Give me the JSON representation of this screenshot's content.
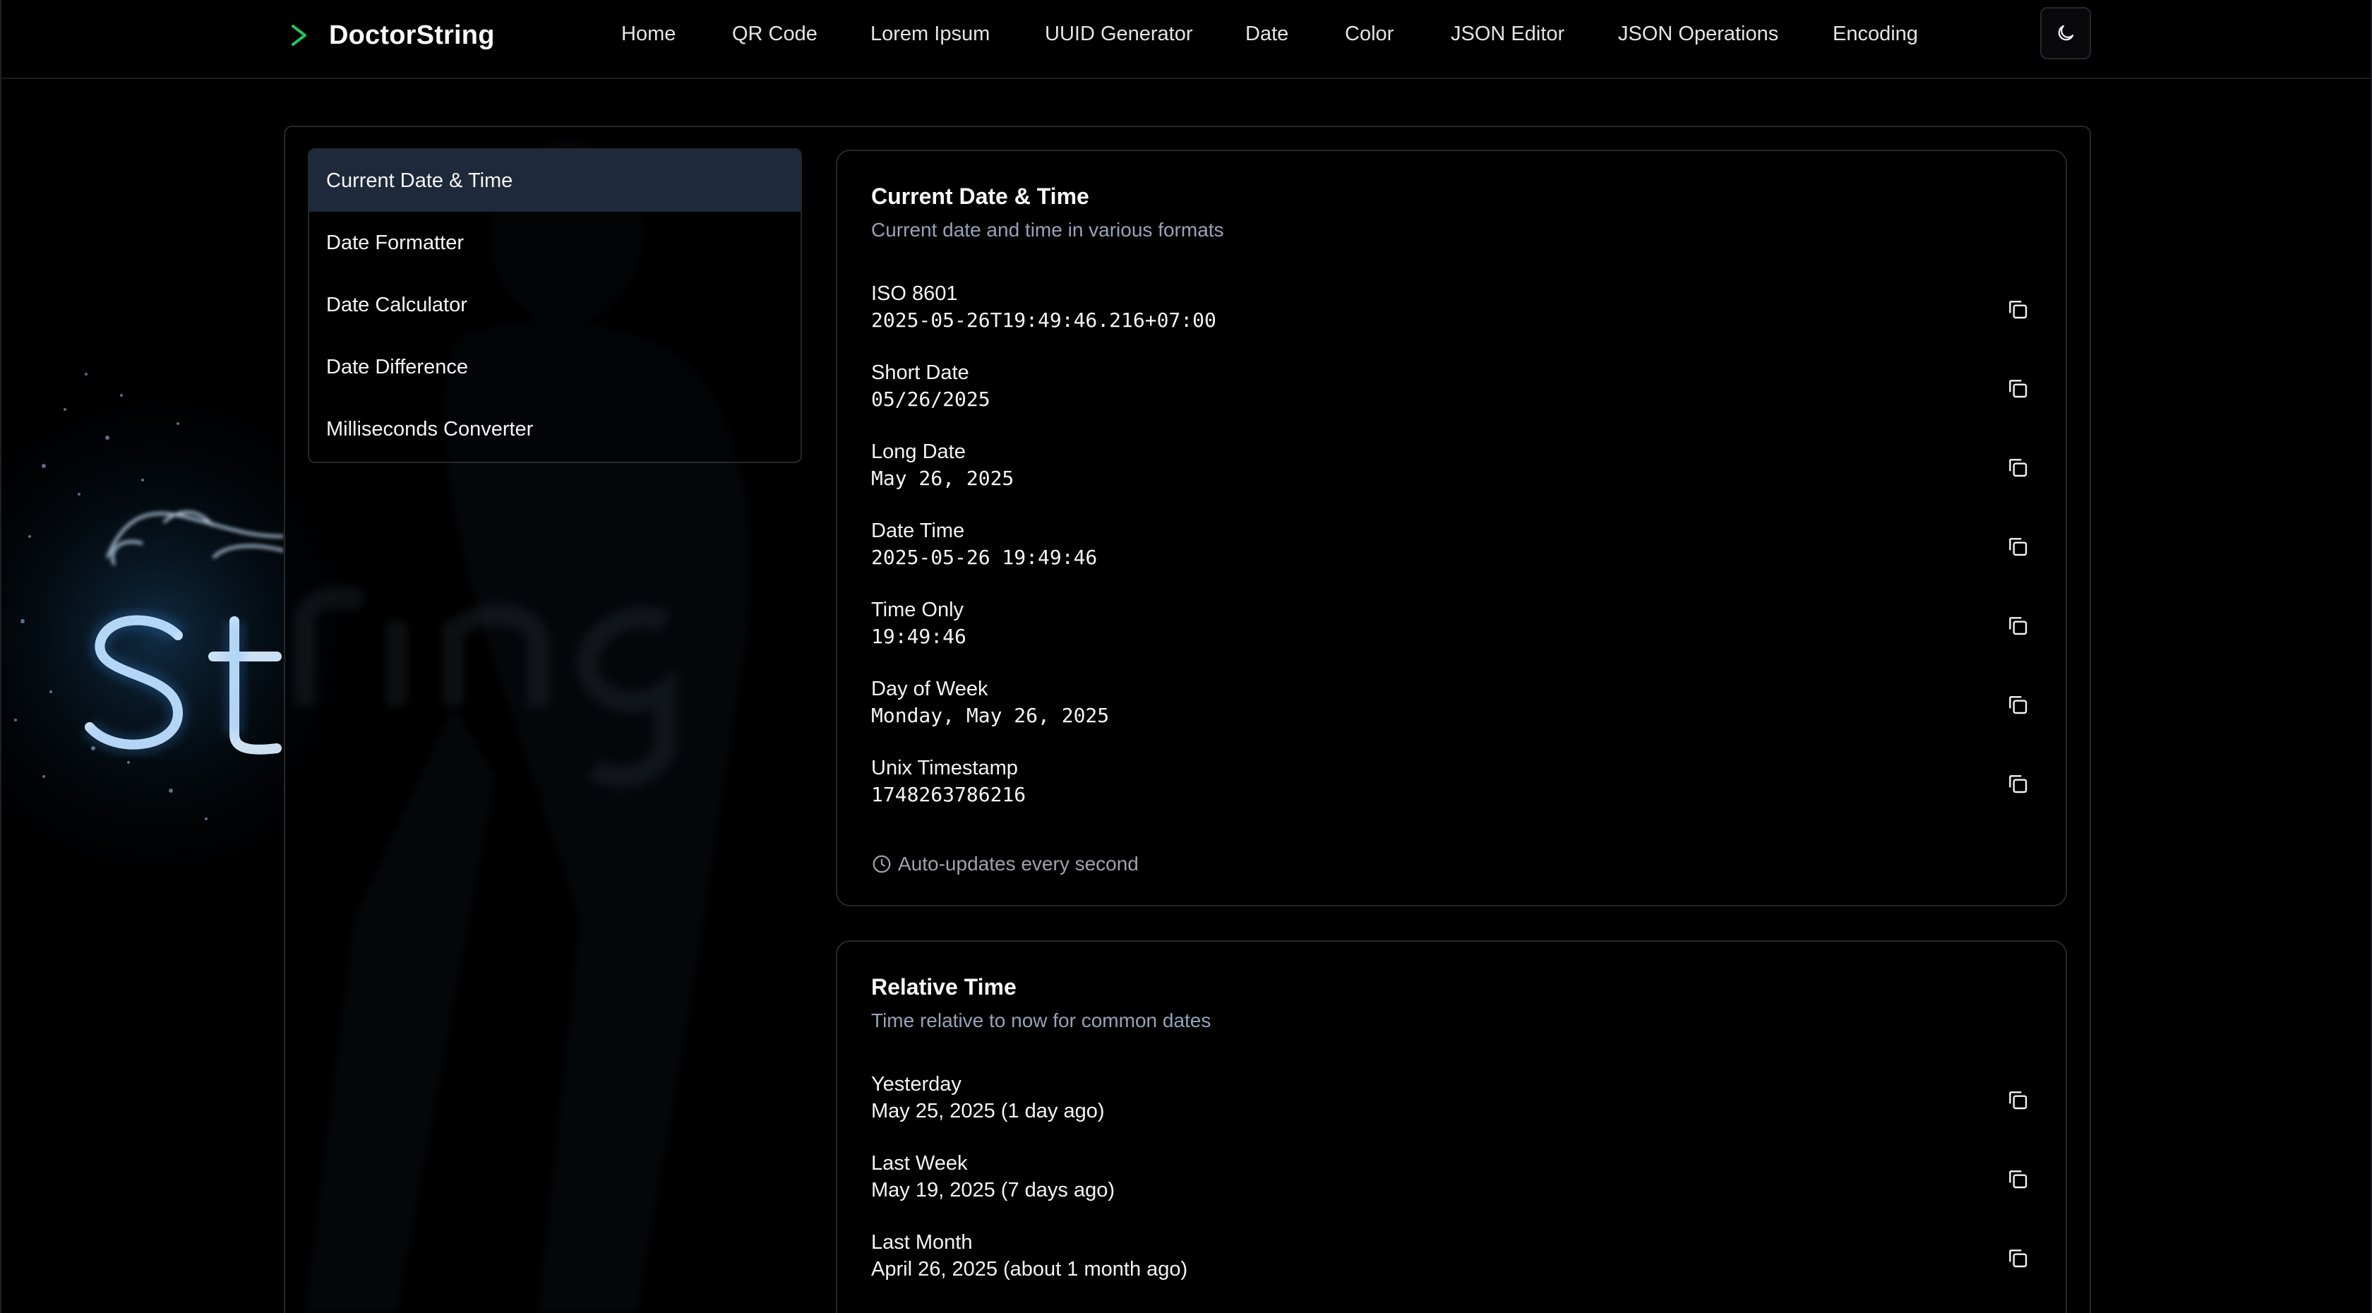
{
  "app": {
    "brand": "DoctorString"
  },
  "nav": {
    "items": [
      "Home",
      "QR Code",
      "Lorem Ipsum",
      "UUID Generator",
      "Date",
      "Color",
      "JSON Editor",
      "JSON Operations",
      "Encoding"
    ]
  },
  "theme_toggle": {
    "icon": "moon-icon"
  },
  "sidebar": {
    "items": [
      {
        "label": "Current Date & Time",
        "active": true
      },
      {
        "label": "Date Formatter",
        "active": false
      },
      {
        "label": "Date Calculator",
        "active": false
      },
      {
        "label": "Date Difference",
        "active": false
      },
      {
        "label": "Milliseconds Converter",
        "active": false
      }
    ]
  },
  "current_card": {
    "title": "Current Date & Time",
    "description": "Current date and time in various formats",
    "rows": [
      {
        "label": "ISO 8601",
        "value": "2025-05-26T19:49:46.216+07:00"
      },
      {
        "label": "Short Date",
        "value": "05/26/2025"
      },
      {
        "label": "Long Date",
        "value": "May 26, 2025"
      },
      {
        "label": "Date Time",
        "value": "2025-05-26 19:49:46"
      },
      {
        "label": "Time Only",
        "value": "19:49:46"
      },
      {
        "label": "Day of Week",
        "value": "Monday, May 26, 2025"
      },
      {
        "label": "Unix Timestamp",
        "value": "1748263786216"
      }
    ],
    "auto_update_note": "Auto-updates every second"
  },
  "relative_card": {
    "title": "Relative Time",
    "description": "Time relative to now for common dates",
    "rows": [
      {
        "label": "Yesterday",
        "value": "May 25, 2025 (1 day ago)"
      },
      {
        "label": "Last Week",
        "value": "May 19, 2025 (7 days ago)"
      },
      {
        "label": "Last Month",
        "value": "April 26, 2025 (about 1 month ago)"
      }
    ]
  },
  "colors": {
    "accent": "#22c55e",
    "active_item_bg": "#1e293b",
    "muted_text": "#94a3b8",
    "border": "#27272a"
  }
}
